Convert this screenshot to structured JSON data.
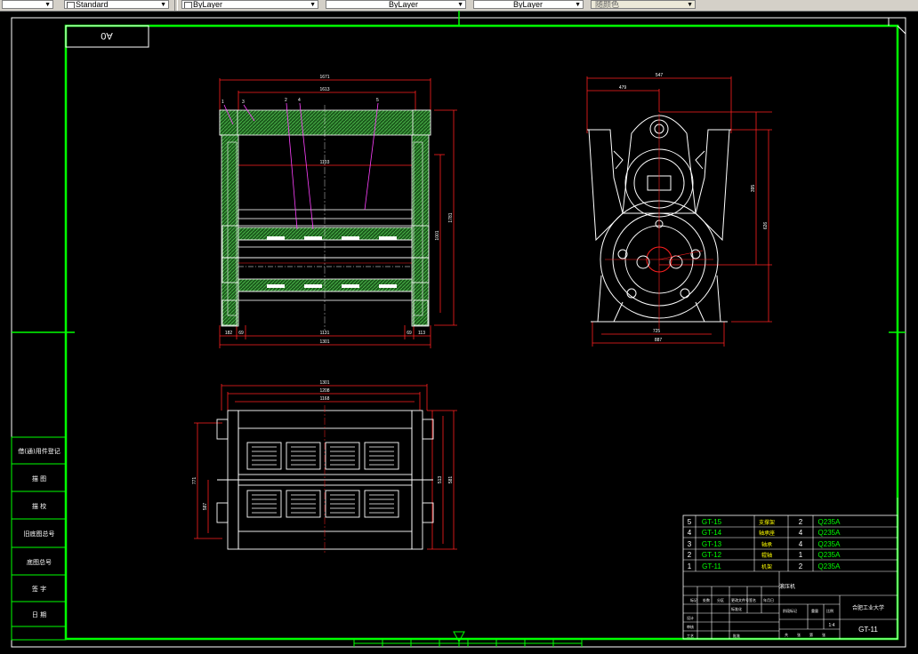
{
  "toolbar": {
    "textstyle": "Standard",
    "layer": "ByLayer",
    "linetype": "ByLayer",
    "lineweight": "ByLayer",
    "plotstyle": "随颜色"
  },
  "drawing": {
    "sheet_size": "A0",
    "left_labels": [
      "借(通)用件登记",
      "描 图",
      "描 校",
      "旧底图总号",
      "底图总号",
      "签 字",
      "日 期"
    ],
    "front_view_dims": [
      "1671",
      "1613",
      "1103",
      "1131",
      "1301",
      "1781",
      "1001",
      "182",
      "69",
      "69",
      "113"
    ],
    "front_view_balloons": [
      "1",
      "3",
      "2",
      "4",
      "5"
    ],
    "side_view_dims": [
      "547",
      "479",
      "395",
      "626",
      "725",
      "887"
    ],
    "top_view_dims": [
      "1301",
      "1208",
      "1168",
      "771",
      "587",
      "513",
      "581"
    ],
    "title_block": {
      "parts": [
        {
          "no": "5",
          "code": "GT-15",
          "name": "支撑架",
          "qty": "2",
          "material": "Q235A"
        },
        {
          "no": "4",
          "code": "GT-14",
          "name": "轴承座",
          "qty": "4",
          "material": "Q235A"
        },
        {
          "no": "3",
          "code": "GT-13",
          "name": "轴承",
          "qty": "4",
          "material": "Q235A"
        },
        {
          "no": "2",
          "code": "GT-12",
          "name": "辊轴",
          "qty": "1",
          "material": "Q235A"
        },
        {
          "no": "1",
          "code": "GT-11",
          "name": "机架",
          "qty": "2",
          "material": "Q235A"
        }
      ],
      "design_label": "滚压机",
      "org_label": "合肥工业大学",
      "drawing_no": "GT-11",
      "scale": "1:4",
      "row_labels": [
        "标记",
        "处数",
        "分区",
        "更改文件号",
        "签名",
        "年月日"
      ],
      "labels_small": [
        "设计",
        "审核",
        "工艺",
        "标准化",
        "阶段标记",
        "重量",
        "比例",
        "批准"
      ],
      "sheet_labels": [
        "共",
        "张",
        "第",
        "张"
      ]
    }
  }
}
